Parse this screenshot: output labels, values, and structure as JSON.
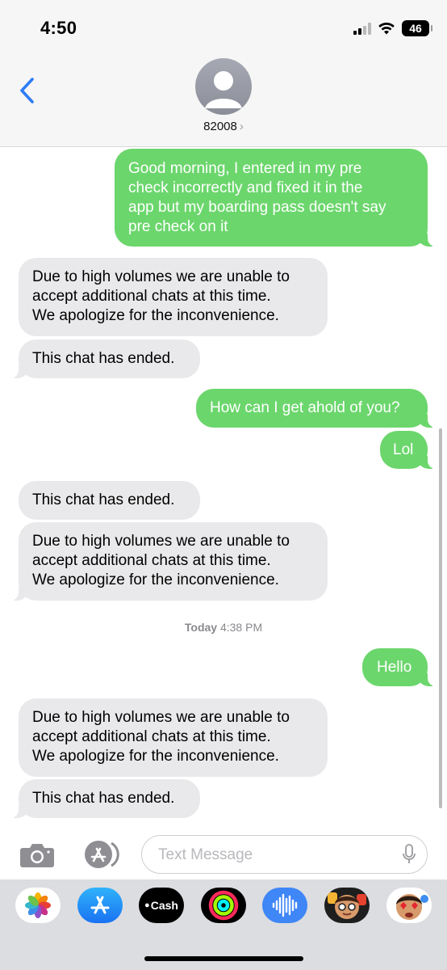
{
  "status_bar": {
    "time": "4:50",
    "battery": "46"
  },
  "header": {
    "contact": "82008",
    "back_icon": "chevron-left-icon",
    "avatar_icon": "person-icon"
  },
  "messages": [
    {
      "from": "me",
      "lines": [
        "Good morning, I entered in my pre",
        "check incorrectly and fixed it in the",
        "app but my boarding pass doesn't say",
        "pre check on it"
      ]
    },
    {
      "from": "them",
      "lines": [
        "Due to high volumes we are unable to",
        "accept additional chats at this time.",
        "We apologize for the inconvenience."
      ]
    },
    {
      "from": "them",
      "lines": [
        "This chat has ended."
      ]
    },
    {
      "from": "me",
      "lines": [
        "How can I get ahold of you?"
      ]
    },
    {
      "from": "me",
      "lines": [
        "Lol"
      ]
    },
    {
      "from": "them",
      "lines": [
        "This chat has ended."
      ]
    },
    {
      "from": "them",
      "lines": [
        "Due to high volumes we are unable to",
        "accept additional chats at this time.",
        "We apologize for the inconvenience."
      ]
    },
    {
      "from": "me",
      "lines": [
        "Hello"
      ]
    },
    {
      "from": "them",
      "lines": [
        "Due to high volumes we are unable to",
        "accept additional chats at this time.",
        "We apologize for the inconvenience."
      ]
    },
    {
      "from": "them",
      "lines": [
        "This chat has ended."
      ]
    }
  ],
  "timestamp": {
    "day": "Today",
    "time": "4:38 PM"
  },
  "composer": {
    "placeholder": "Text Message",
    "camera_icon": "camera-icon",
    "apps_icon": "app-store-icon",
    "mic_icon": "microphone-icon"
  },
  "app_tray": {
    "apps": [
      {
        "name": "photos-icon"
      },
      {
        "name": "app-store-icon"
      },
      {
        "name": "apple-cash-icon",
        "label": "Cash"
      },
      {
        "name": "activity-icon"
      },
      {
        "name": "audio-message-icon"
      },
      {
        "name": "memoji-icon"
      },
      {
        "name": "memoji-stickers-icon"
      }
    ]
  },
  "colors": {
    "outgoing": "#6bd66c",
    "incoming": "#e9e9eb",
    "accent": "#2f7cf6"
  }
}
